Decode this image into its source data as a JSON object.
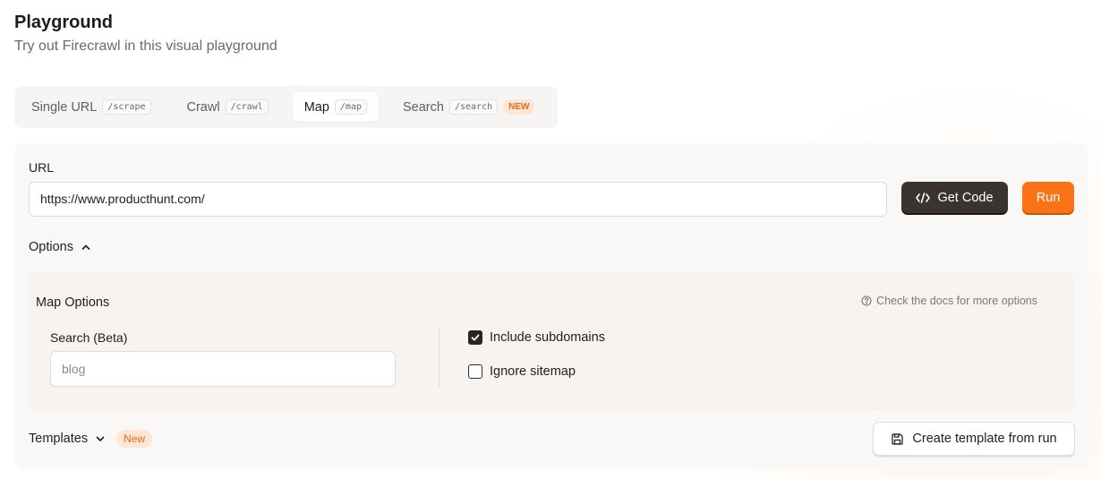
{
  "header": {
    "title": "Playground",
    "subtitle": "Try out Firecrawl in this visual playground"
  },
  "tabs": [
    {
      "label": "Single URL",
      "code": "/scrape",
      "active": false
    },
    {
      "label": "Crawl",
      "code": "/crawl",
      "active": false
    },
    {
      "label": "Map",
      "code": "/map",
      "active": true
    },
    {
      "label": "Search",
      "code": "/search",
      "active": false,
      "badge": "NEW"
    }
  ],
  "url": {
    "label": "URL",
    "value": "https://www.producthunt.com/"
  },
  "actions": {
    "get_code_label": "Get Code",
    "run_label": "Run"
  },
  "options": {
    "toggle_label": "Options",
    "section_title": "Map Options",
    "docs_hint": "Check the docs for more options",
    "search_label": "Search (Beta)",
    "search_placeholder": "blog",
    "include_subdomains": {
      "label": "Include subdomains",
      "checked": true
    },
    "ignore_sitemap": {
      "label": "Ignore sitemap",
      "checked": false
    }
  },
  "templates": {
    "toggle_label": "Templates",
    "badge": "New",
    "create_button_label": "Create template from run"
  },
  "colors": {
    "accent": "#f97316",
    "dark_button": "#3a3330",
    "badge_bg": "#fde6d6",
    "badge_text": "#f06a1e"
  }
}
